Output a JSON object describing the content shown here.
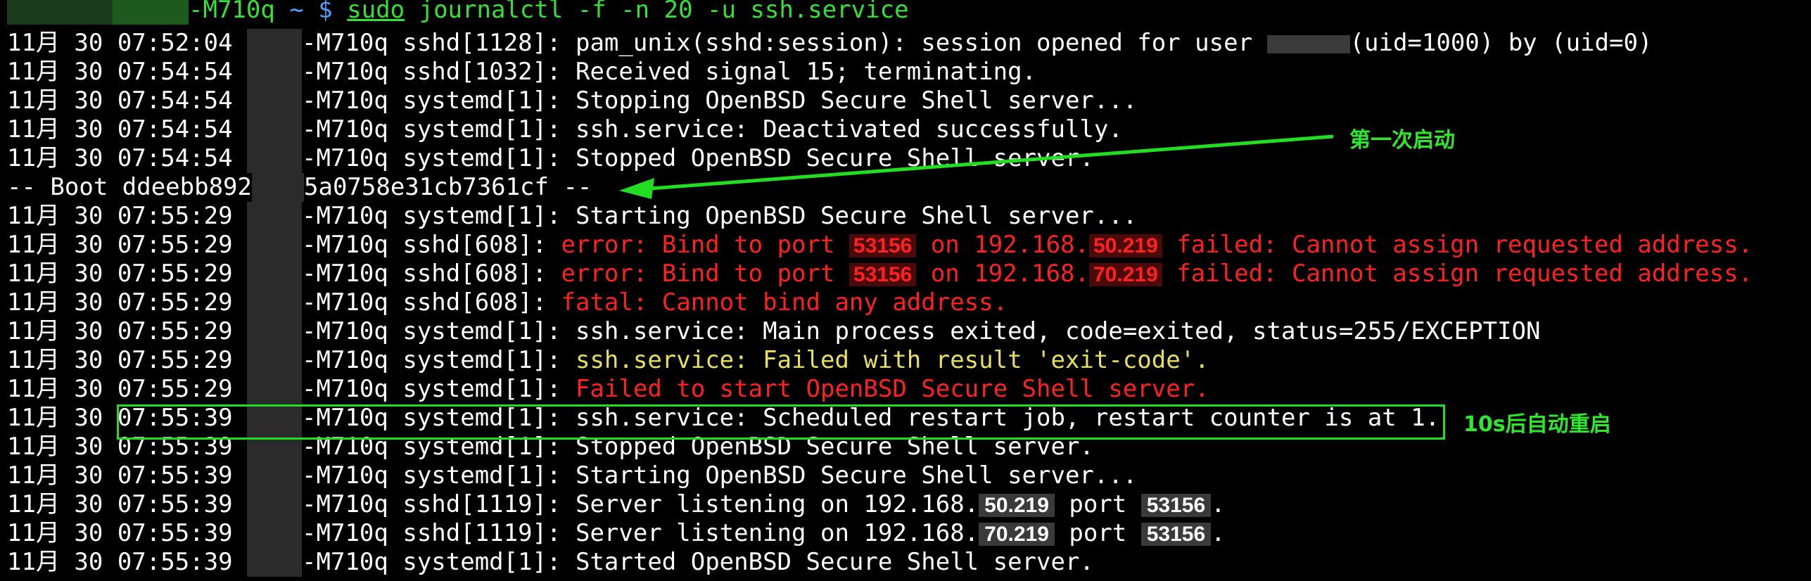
{
  "prompt": {
    "host_suffix": "-M710q",
    "cwd": "~",
    "dollar": "$",
    "sudo": "sudo",
    "command": " journalctl -f -n 20 -u ssh.service"
  },
  "log": [
    {
      "date": "11月 30 07:52:04 ",
      "host": "-M710q ",
      "src": "sshd[1128]: ",
      "msg": "pam_unix(sshd:session): session opened for user ",
      "msg2": "(uid=1000) by (uid=0)",
      "style": "white"
    },
    {
      "date": "11月 30 07:54:54 ",
      "host": "-M710q ",
      "src": "sshd[1032]: ",
      "msg": "Received signal 15; terminating.",
      "style": "white"
    },
    {
      "date": "11月 30 07:54:54 ",
      "host": "-M710q ",
      "src": "systemd[1]: ",
      "msg": "Stopping OpenBSD Secure Shell server...",
      "style": "white"
    },
    {
      "date": "11月 30 07:54:54 ",
      "host": "-M710q ",
      "src": "systemd[1]: ",
      "msg": "ssh.service: Deactivated successfully.",
      "style": "white"
    },
    {
      "date": "11月 30 07:54:54 ",
      "host": "-M710q ",
      "src": "systemd[1]: ",
      "msg": "Stopped OpenBSD Secure Shell server.",
      "style": "white"
    },
    {
      "boot_prefix": "-- Boot ddeebb892",
      "boot_suffix": "5a0758e31cb7361cf --"
    },
    {
      "date": "11月 30 07:55:29 ",
      "host": "-M710q ",
      "src": "systemd[1]: ",
      "msg": "Starting OpenBSD Secure Shell server...",
      "style": "white"
    },
    {
      "date": "11月 30 07:55:29 ",
      "host": "-M710q ",
      "src": "sshd[608]: ",
      "msg": "error: Bind to port ",
      "port": "53156",
      "mid": " on 192.168.",
      "ip": "50.219",
      "tail": " failed: Cannot assign requested address.",
      "style": "red"
    },
    {
      "date": "11月 30 07:55:29 ",
      "host": "-M710q ",
      "src": "sshd[608]: ",
      "msg": "error: Bind to port ",
      "port": "53156",
      "mid": " on 192.168.",
      "ip": "70.219",
      "tail": " failed: Cannot assign requested address.",
      "style": "red"
    },
    {
      "date": "11月 30 07:55:29 ",
      "host": "-M710q ",
      "src": "sshd[608]: ",
      "msg": "fatal: Cannot bind any address.",
      "style": "red"
    },
    {
      "date": "11月 30 07:55:29 ",
      "host": "-M710q ",
      "src": "systemd[1]: ",
      "msg": "ssh.service: Main process exited, code=exited, status=255/EXCEPTION",
      "style": "white"
    },
    {
      "date": "11月 30 07:55:29 ",
      "host": "-M710q ",
      "src": "systemd[1]: ",
      "msg": "ssh.service: Failed with result 'exit-code'.",
      "style": "yellow"
    },
    {
      "date": "11月 30 07:55:29 ",
      "host": "-M710q ",
      "src": "systemd[1]: ",
      "msg": "Failed to start OpenBSD Secure Shell server.",
      "style": "red"
    },
    {
      "date": "11月 30 07:55:39 ",
      "host": "-M710q ",
      "src": "systemd[1]: ",
      "msg": "ssh.service: Scheduled restart job, restart counter is at 1.",
      "style": "white"
    },
    {
      "date": "11月 30 07:55:39 ",
      "host": "-M710q ",
      "src": "systemd[1]: ",
      "msg": "Stopped OpenBSD Secure Shell server.",
      "style": "white"
    },
    {
      "date": "11月 30 07:55:39 ",
      "host": "-M710q ",
      "src": "systemd[1]: ",
      "msg": "Starting OpenBSD Secure Shell server...",
      "style": "white"
    },
    {
      "date": "11月 30 07:55:39 ",
      "host": "-M710q ",
      "src": "sshd[1119]: ",
      "msg": "Server listening on 192.168.",
      "ip": "50.219",
      "mid": " port ",
      "port": "53156",
      "tail": ".",
      "style": "white"
    },
    {
      "date": "11月 30 07:55:39 ",
      "host": "-M710q ",
      "src": "sshd[1119]: ",
      "msg": "Server listening on 192.168.",
      "ip": "70.219",
      "mid": " port ",
      "port": "53156",
      "tail": ".",
      "style": "white"
    },
    {
      "date": "11月 30 07:55:39 ",
      "host": "-M710q ",
      "src": "systemd[1]: ",
      "msg": "Started OpenBSD Secure Shell server.",
      "style": "white"
    }
  ],
  "annotations": {
    "first_boot": "第一次启动",
    "auto_restart": "10s后自动重启"
  },
  "colors": {
    "background": "#000000",
    "prompt_green": "#34e134",
    "prompt_blue": "#4aa0ff",
    "error_red": "#ff2020",
    "warn_yellow": "#e6e05a",
    "annotation_green": "#22dd22"
  }
}
